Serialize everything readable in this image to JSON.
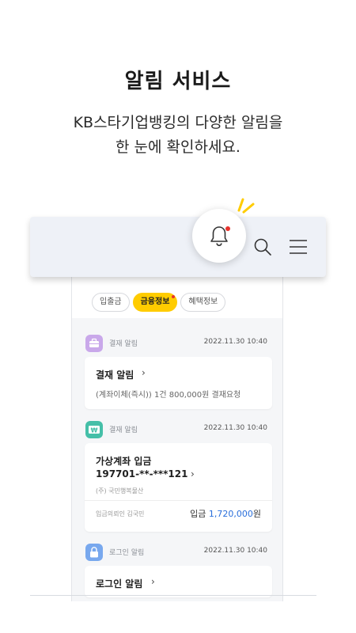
{
  "hero": {
    "title": "알림 서비스",
    "subtitle_line1": "KB스타기업뱅킹의 다양한 알림을",
    "subtitle_line2": "한 눈에 확인하세요."
  },
  "tabs": [
    {
      "label": "입출금",
      "active": false
    },
    {
      "label": "금융정보",
      "active": true,
      "new_dot": true
    },
    {
      "label": "혜택정보",
      "active": false
    }
  ],
  "notifications": [
    {
      "category": "결재 알림",
      "icon": "briefcase-icon",
      "icon_color": "#b58ed9",
      "date": "2022.11.30 10:40",
      "title": "결재 알림",
      "detail": "(계좌이체(즉시)) 1건 800,000원 결재요청"
    },
    {
      "category": "결재 알림",
      "icon": "won-icon",
      "icon_color": "#3fb8a2",
      "date": "2022.11.30 10:40",
      "title_line1": "가상계좌 입금",
      "title_line2": "197701-**-***121",
      "company": "(주) 국민행복물산",
      "depositor": "입금의뢰인 김국민",
      "amount_label": "입금",
      "amount_value": "1,720,000",
      "amount_unit": "원"
    },
    {
      "category": "로그인 알림",
      "icon": "lock-icon",
      "icon_color": "#6fa0e8",
      "date": "2022.11.30 10:40",
      "title": "로그인 알림"
    }
  ],
  "colors": {
    "accent": "#ffcc00",
    "amount_blue": "#2a6fdb",
    "alert_red": "#e8332d"
  }
}
